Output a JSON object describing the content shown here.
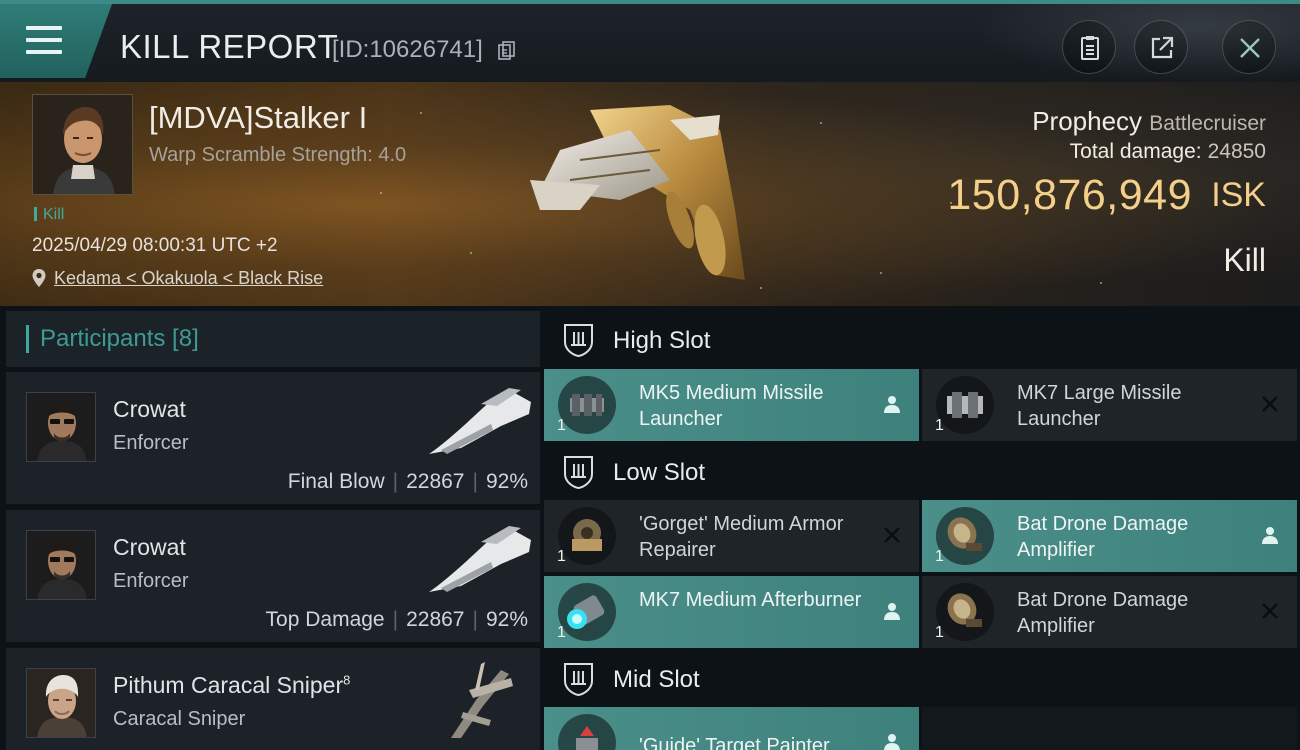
{
  "topbar": {
    "title": "KILL REPORT",
    "report_id": "[ID:10626741]"
  },
  "victim": {
    "name": "[MDVA]Stalker I",
    "warp_scramble": "Warp Scramble Strength: 4.0",
    "tag": "Kill",
    "timestamp": "2025/04/29 08:00:31 UTC +2",
    "location": "Kedama < Okakuola < Black Rise",
    "ship_name": "Prophecy",
    "ship_class": "Battlecruiser",
    "total_damage_label": "Total damage:",
    "total_damage": "24850",
    "isk_value": "150,876,949",
    "isk_unit": "ISK",
    "result": "Kill"
  },
  "participants": {
    "header": "Participants [8]",
    "items": [
      {
        "name": "Crowat",
        "sup": "",
        "ship": "Enforcer",
        "role": "Final Blow",
        "damage": "22867",
        "percent": "92%"
      },
      {
        "name": "Crowat",
        "sup": "",
        "ship": "Enforcer",
        "role": "Top Damage",
        "damage": "22867",
        "percent": "92%"
      },
      {
        "name": "Pithum Caracal Sniper",
        "sup": "8",
        "ship": "Caracal Sniper",
        "role": "",
        "damage": "",
        "percent": ""
      }
    ]
  },
  "slots": {
    "high": {
      "label": "High Slot",
      "modules": [
        {
          "qty": "1",
          "name": "MK5 Medium Missile Launcher",
          "active": true
        },
        {
          "qty": "1",
          "name": "MK7 Large Missile Launcher",
          "active": false
        }
      ]
    },
    "low": {
      "label": "Low Slot",
      "modules": [
        {
          "qty": "1",
          "name": "'Gorget' Medium Armor Repairer",
          "active": false
        },
        {
          "qty": "1",
          "name": "Bat Drone Damage Amplifier",
          "active": true
        },
        {
          "qty": "1",
          "name": "MK7 Medium Afterburner",
          "active": true
        },
        {
          "qty": "1",
          "name": "Bat Drone Damage Amplifier",
          "active": false
        }
      ]
    },
    "mid": {
      "label": "Mid Slot",
      "modules": [
        {
          "qty": "",
          "name": "'Guide' Target Painter",
          "active": true
        }
      ]
    }
  },
  "colors": {
    "accent": "#3fa89e",
    "isk": "#f3cf8a",
    "active_module": "#4b8f8a"
  },
  "icons": [
    "menu-icon",
    "copy-icon",
    "clipboard-icon",
    "share-icon",
    "close-icon",
    "location-pin-icon",
    "shield-icon",
    "pilot-icon",
    "destroyed-x-icon"
  ]
}
